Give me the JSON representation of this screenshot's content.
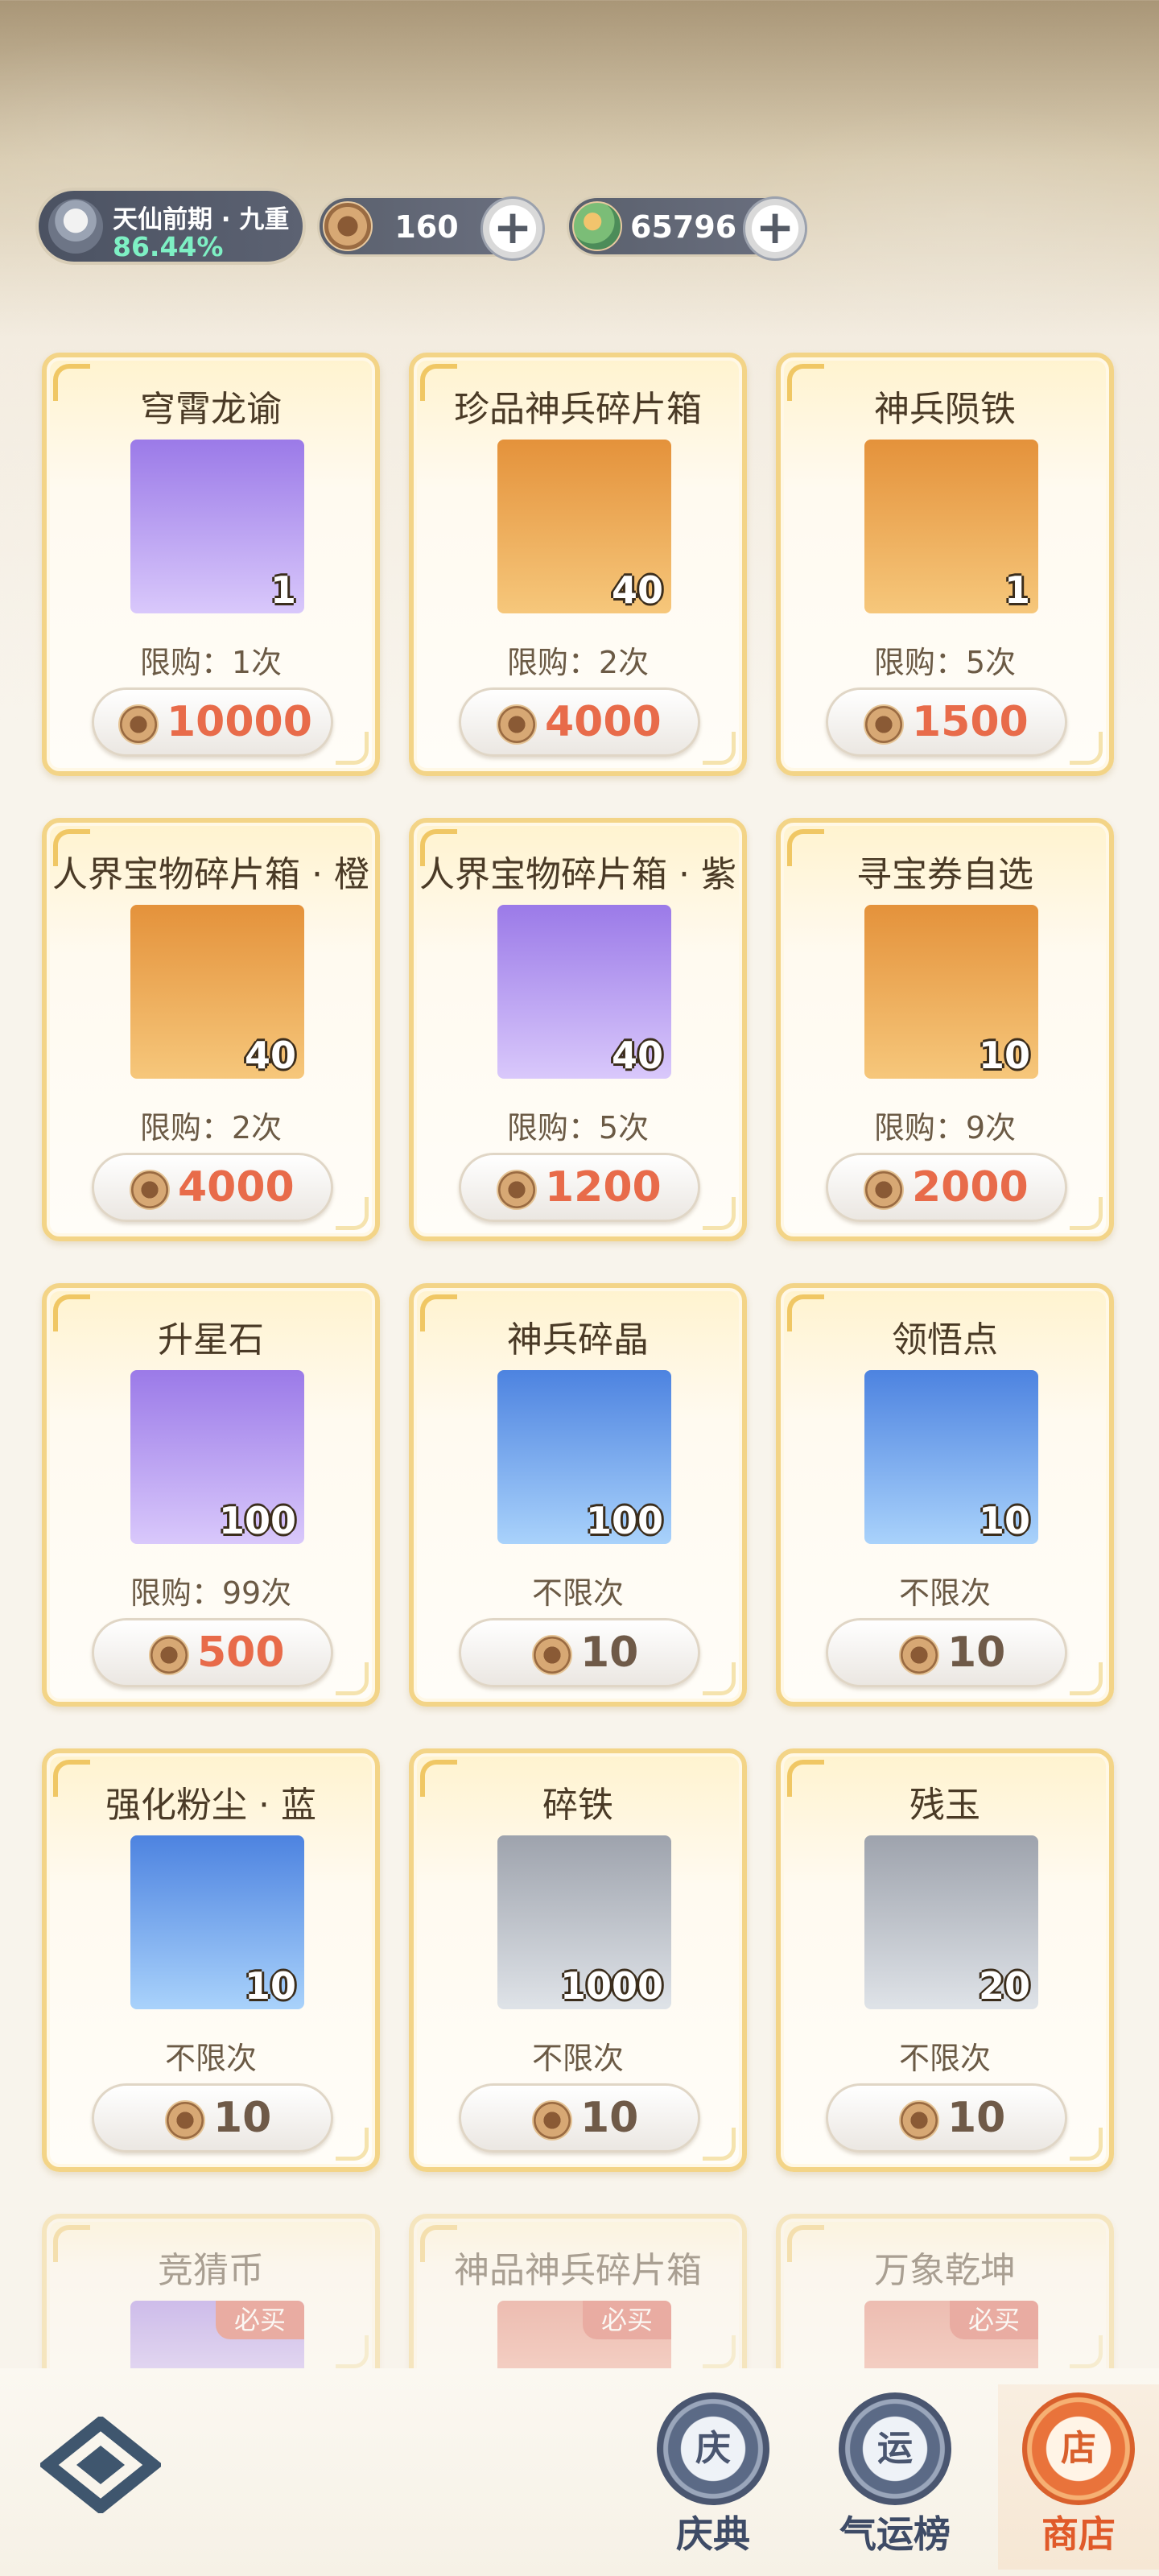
{
  "header": {
    "realm_title": "天仙前期 · 九重",
    "realm_progress": "86.44%",
    "currency_jade": {
      "value": "160",
      "icon": "copper-coin-icon"
    },
    "currency_spirit": {
      "value": "65796",
      "icon": "spirit-stone-icon"
    },
    "add_label": "+"
  },
  "shop": {
    "items": [
      {
        "name": "穹霄龙谕",
        "qty": "1",
        "limit": "限购：1次",
        "price": "10000",
        "price_style": "red",
        "bg": "purple",
        "icon": "antler-horns-icon"
      },
      {
        "name": "珍品神兵碎片箱",
        "qty": "40",
        "limit": "限购：2次",
        "price": "4000",
        "price_style": "red",
        "bg": "orange",
        "icon": "dragon-chest-icon"
      },
      {
        "name": "神兵陨铁",
        "qty": "1",
        "limit": "限购：5次",
        "price": "1500",
        "price_style": "red",
        "bg": "orange",
        "icon": "meteor-iron-icon"
      },
      {
        "name": "人界宝物碎片箱 · 橙",
        "qty": "40",
        "limit": "限购：2次",
        "price": "4000",
        "price_style": "red",
        "bg": "orange",
        "icon": "red-chest-icon"
      },
      {
        "name": "人界宝物碎片箱 · 紫",
        "qty": "40",
        "limit": "限购：5次",
        "price": "1200",
        "price_style": "red",
        "bg": "purple",
        "icon": "red-chest-icon"
      },
      {
        "name": "寻宝券自选",
        "qty": "10",
        "limit": "限购：9次",
        "price": "2000",
        "price_style": "red",
        "bg": "orange",
        "icon": "treasure-box-icon"
      },
      {
        "name": "升星石",
        "qty": "100",
        "limit": "限购：99次",
        "price": "500",
        "price_style": "red",
        "bg": "purple",
        "icon": "purple-crystal-icon"
      },
      {
        "name": "神兵碎晶",
        "qty": "100",
        "limit": "不限次",
        "price": "10",
        "price_style": "dark",
        "bg": "blue",
        "icon": "blue-crystal-icon"
      },
      {
        "name": "领悟点",
        "qty": "10",
        "limit": "不限次",
        "price": "10",
        "price_style": "dark",
        "bg": "blue",
        "icon": "jade-hook-icon"
      },
      {
        "name": "强化粉尘 · 蓝",
        "qty": "10",
        "limit": "不限次",
        "price": "10",
        "price_style": "dark",
        "bg": "blue",
        "icon": "dust-pile-icon"
      },
      {
        "name": "碎铁",
        "qty": "1000",
        "limit": "不限次",
        "price": "10",
        "price_style": "dark",
        "bg": "gray",
        "icon": "iron-ore-icon"
      },
      {
        "name": "残玉",
        "qty": "20",
        "limit": "不限次",
        "price": "10",
        "price_style": "dark",
        "bg": "gray",
        "icon": "jade-stone-icon"
      }
    ],
    "partial_items": [
      {
        "name": "竞猜币",
        "badge": "必买",
        "bg": "purple"
      },
      {
        "name": "神品神兵碎片箱",
        "badge": "必买",
        "bg": "red"
      },
      {
        "name": "万象乾坤",
        "badge": "必买",
        "bg": "red"
      }
    ]
  },
  "nav": {
    "tabs": [
      {
        "label": "庆典",
        "glyph": "庆",
        "active": false
      },
      {
        "label": "气运榜",
        "glyph": "运",
        "active": false
      },
      {
        "label": "商店",
        "glyph": "店",
        "active": true
      }
    ]
  }
}
